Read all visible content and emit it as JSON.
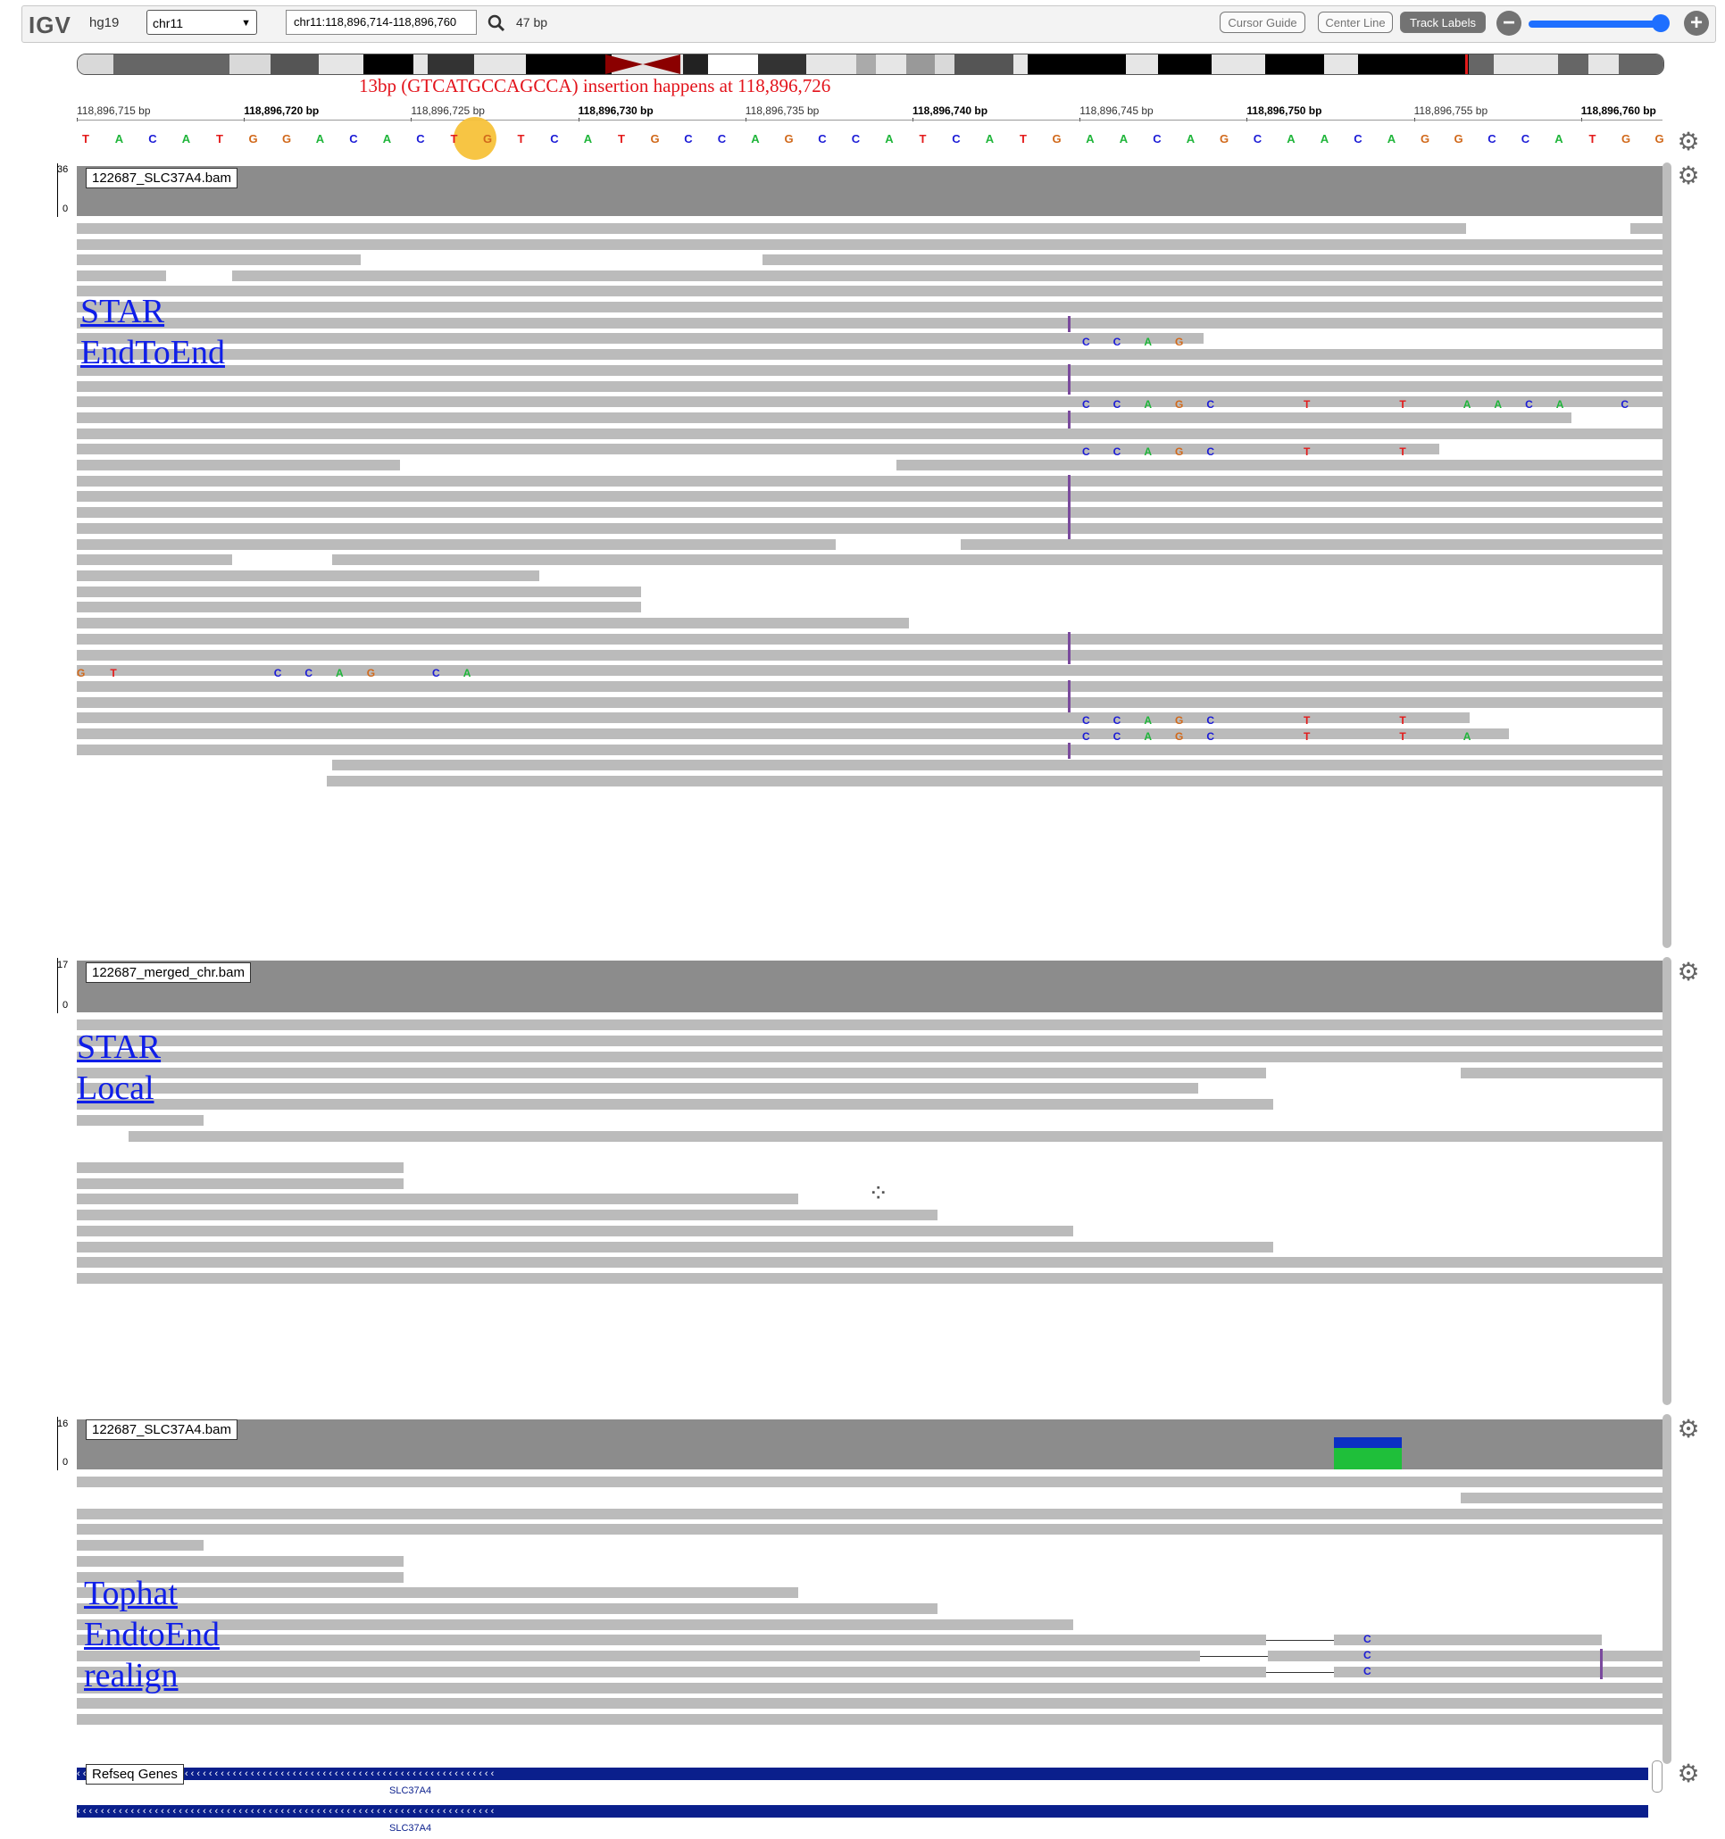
{
  "navbar": {
    "logo": "IGV",
    "genome": "hg19",
    "chromosome": "chr11",
    "locus": "chr11:118,896,714-118,896,760",
    "width_label": "47 bp",
    "buttons": {
      "cursor_guide": "Cursor Guide",
      "center_line": "Center Line",
      "track_labels": "Track Labels"
    },
    "zoom_out": "−",
    "zoom_in": "+",
    "zoom_level": 0.9
  },
  "annotation": "13bp (GTCATGCCAGCCA) insertion happens at 118,896,726",
  "ruler": {
    "ticks": [
      "118,896,715 bp",
      "118,896,720 bp",
      "118,896,725 bp",
      "118,896,730 bp",
      "118,896,735 bp",
      "118,896,740 bp",
      "118,896,745 bp",
      "118,896,750 bp",
      "118,896,755 bp",
      "118,896,760 bp"
    ],
    "bold": [
      false,
      true,
      false,
      true,
      false,
      true,
      false,
      true,
      false,
      true
    ]
  },
  "sequence": [
    "T",
    "A",
    "C",
    "A",
    "T",
    "G",
    "G",
    "A",
    "C",
    "A",
    "C",
    "T",
    "G",
    "T",
    "C",
    "A",
    "T",
    "G",
    "C",
    "C",
    "A",
    "G",
    "C",
    "C",
    "A",
    "T",
    "C",
    "A",
    "T",
    "G",
    "A",
    "A",
    "C",
    "A",
    "G",
    "C",
    "A",
    "A",
    "C",
    "A",
    "G",
    "G",
    "C",
    "C",
    "A",
    "T",
    "G",
    "G"
  ],
  "tracks": [
    {
      "name": "122687_SLC37A4.bam",
      "max": "36",
      "min": "0",
      "tag_lines": [
        "STAR",
        "EndToEnd"
      ]
    },
    {
      "name": "122687_merged_chr.bam",
      "max": "17",
      "min": "0",
      "tag_lines": [
        "STAR",
        "Local"
      ]
    },
    {
      "name": "122687_SLC37A4.bam",
      "max": "16",
      "min": "0",
      "tag_lines": [
        "Tophat",
        "EndtoEnd",
        "realign"
      ]
    }
  ],
  "genes": {
    "track_name": "Refseq Genes",
    "gene_name": "SLC37A4"
  },
  "colors": {
    "A": "#1fb53a",
    "C": "#1b1bd6",
    "G": "#d1691b",
    "T": "#e31b1b",
    "insertion": "#7a4a9d",
    "gene": "#0a1f8c"
  }
}
